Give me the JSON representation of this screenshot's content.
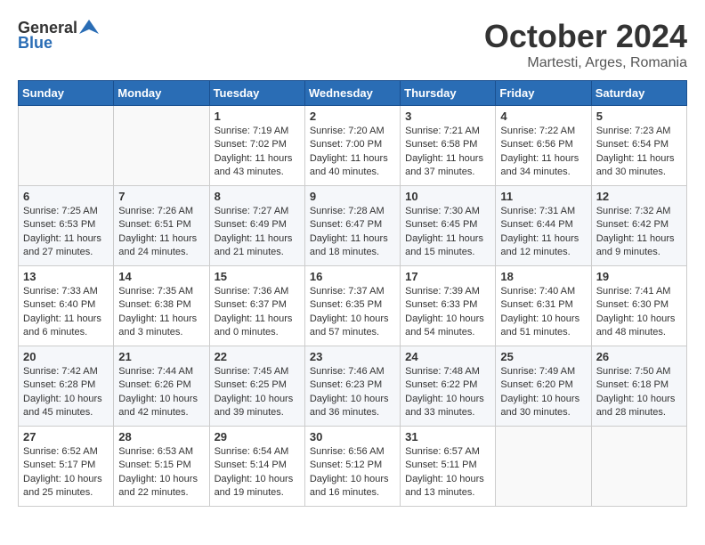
{
  "logo": {
    "general": "General",
    "blue": "Blue"
  },
  "header": {
    "month": "October 2024",
    "location": "Martesti, Arges, Romania"
  },
  "weekdays": [
    "Sunday",
    "Monday",
    "Tuesday",
    "Wednesday",
    "Thursday",
    "Friday",
    "Saturday"
  ],
  "weeks": [
    [
      {
        "day": "",
        "content": ""
      },
      {
        "day": "",
        "content": ""
      },
      {
        "day": "1",
        "content": "Sunrise: 7:19 AM\nSunset: 7:02 PM\nDaylight: 11 hours and 43 minutes."
      },
      {
        "day": "2",
        "content": "Sunrise: 7:20 AM\nSunset: 7:00 PM\nDaylight: 11 hours and 40 minutes."
      },
      {
        "day": "3",
        "content": "Sunrise: 7:21 AM\nSunset: 6:58 PM\nDaylight: 11 hours and 37 minutes."
      },
      {
        "day": "4",
        "content": "Sunrise: 7:22 AM\nSunset: 6:56 PM\nDaylight: 11 hours and 34 minutes."
      },
      {
        "day": "5",
        "content": "Sunrise: 7:23 AM\nSunset: 6:54 PM\nDaylight: 11 hours and 30 minutes."
      }
    ],
    [
      {
        "day": "6",
        "content": "Sunrise: 7:25 AM\nSunset: 6:53 PM\nDaylight: 11 hours and 27 minutes."
      },
      {
        "day": "7",
        "content": "Sunrise: 7:26 AM\nSunset: 6:51 PM\nDaylight: 11 hours and 24 minutes."
      },
      {
        "day": "8",
        "content": "Sunrise: 7:27 AM\nSunset: 6:49 PM\nDaylight: 11 hours and 21 minutes."
      },
      {
        "day": "9",
        "content": "Sunrise: 7:28 AM\nSunset: 6:47 PM\nDaylight: 11 hours and 18 minutes."
      },
      {
        "day": "10",
        "content": "Sunrise: 7:30 AM\nSunset: 6:45 PM\nDaylight: 11 hours and 15 minutes."
      },
      {
        "day": "11",
        "content": "Sunrise: 7:31 AM\nSunset: 6:44 PM\nDaylight: 11 hours and 12 minutes."
      },
      {
        "day": "12",
        "content": "Sunrise: 7:32 AM\nSunset: 6:42 PM\nDaylight: 11 hours and 9 minutes."
      }
    ],
    [
      {
        "day": "13",
        "content": "Sunrise: 7:33 AM\nSunset: 6:40 PM\nDaylight: 11 hours and 6 minutes."
      },
      {
        "day": "14",
        "content": "Sunrise: 7:35 AM\nSunset: 6:38 PM\nDaylight: 11 hours and 3 minutes."
      },
      {
        "day": "15",
        "content": "Sunrise: 7:36 AM\nSunset: 6:37 PM\nDaylight: 11 hours and 0 minutes."
      },
      {
        "day": "16",
        "content": "Sunrise: 7:37 AM\nSunset: 6:35 PM\nDaylight: 10 hours and 57 minutes."
      },
      {
        "day": "17",
        "content": "Sunrise: 7:39 AM\nSunset: 6:33 PM\nDaylight: 10 hours and 54 minutes."
      },
      {
        "day": "18",
        "content": "Sunrise: 7:40 AM\nSunset: 6:31 PM\nDaylight: 10 hours and 51 minutes."
      },
      {
        "day": "19",
        "content": "Sunrise: 7:41 AM\nSunset: 6:30 PM\nDaylight: 10 hours and 48 minutes."
      }
    ],
    [
      {
        "day": "20",
        "content": "Sunrise: 7:42 AM\nSunset: 6:28 PM\nDaylight: 10 hours and 45 minutes."
      },
      {
        "day": "21",
        "content": "Sunrise: 7:44 AM\nSunset: 6:26 PM\nDaylight: 10 hours and 42 minutes."
      },
      {
        "day": "22",
        "content": "Sunrise: 7:45 AM\nSunset: 6:25 PM\nDaylight: 10 hours and 39 minutes."
      },
      {
        "day": "23",
        "content": "Sunrise: 7:46 AM\nSunset: 6:23 PM\nDaylight: 10 hours and 36 minutes."
      },
      {
        "day": "24",
        "content": "Sunrise: 7:48 AM\nSunset: 6:22 PM\nDaylight: 10 hours and 33 minutes."
      },
      {
        "day": "25",
        "content": "Sunrise: 7:49 AM\nSunset: 6:20 PM\nDaylight: 10 hours and 30 minutes."
      },
      {
        "day": "26",
        "content": "Sunrise: 7:50 AM\nSunset: 6:18 PM\nDaylight: 10 hours and 28 minutes."
      }
    ],
    [
      {
        "day": "27",
        "content": "Sunrise: 6:52 AM\nSunset: 5:17 PM\nDaylight: 10 hours and 25 minutes."
      },
      {
        "day": "28",
        "content": "Sunrise: 6:53 AM\nSunset: 5:15 PM\nDaylight: 10 hours and 22 minutes."
      },
      {
        "day": "29",
        "content": "Sunrise: 6:54 AM\nSunset: 5:14 PM\nDaylight: 10 hours and 19 minutes."
      },
      {
        "day": "30",
        "content": "Sunrise: 6:56 AM\nSunset: 5:12 PM\nDaylight: 10 hours and 16 minutes."
      },
      {
        "day": "31",
        "content": "Sunrise: 6:57 AM\nSunset: 5:11 PM\nDaylight: 10 hours and 13 minutes."
      },
      {
        "day": "",
        "content": ""
      },
      {
        "day": "",
        "content": ""
      }
    ]
  ]
}
